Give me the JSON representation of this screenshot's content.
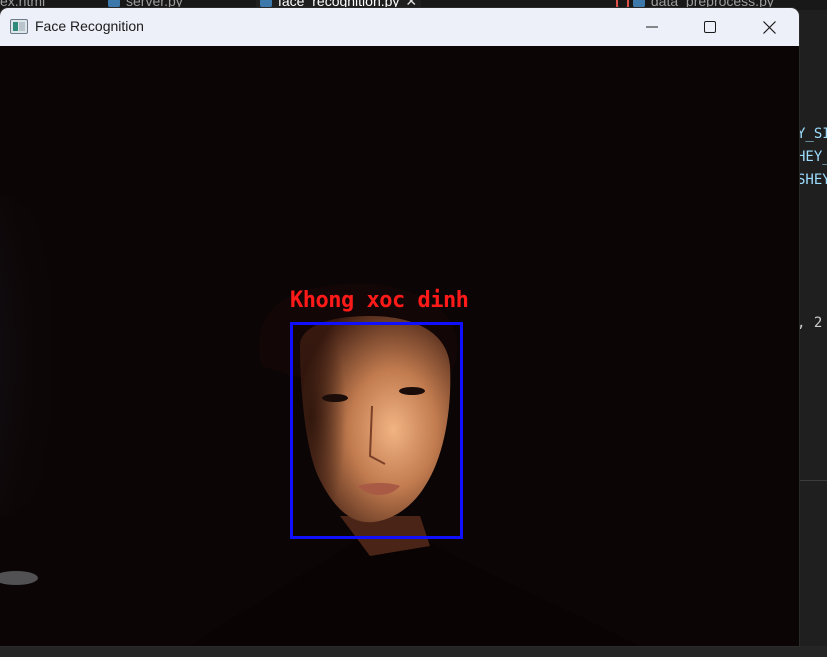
{
  "editor": {
    "tabs": [
      {
        "label": "ex.html"
      },
      {
        "label": "server.py"
      },
      {
        "label": "face_recognition.py"
      },
      {
        "label": "data_preprocess.py"
      }
    ],
    "code_fragments": [
      "Y_SI",
      "HEY_",
      "SHEY",
      ", 2"
    ]
  },
  "window": {
    "title": "Face Recognition",
    "controls": {
      "minimize": "minimize-icon",
      "maximize": "maximize-icon",
      "close": "close-icon"
    }
  },
  "detection": {
    "label": "Khong xoc dinh",
    "box_color": "#1010ff",
    "label_color": "#ff1a1a"
  }
}
